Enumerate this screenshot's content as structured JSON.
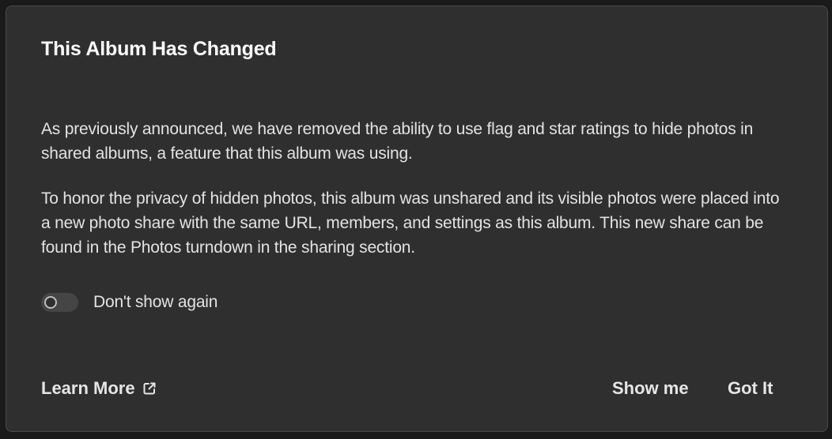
{
  "dialog": {
    "title": "This Album Has Changed",
    "paragraph1": "As previously announced, we have removed the ability to use flag and star ratings to hide photos in shared albums, a feature that this album was using.",
    "paragraph2": "To honor the privacy of hidden photos, this album was unshared and its visible photos were placed into a new photo share with the same URL, members, and settings as this album. This new share can be found in the Photos turndown in the sharing section.",
    "toggle": {
      "label": "Don't show again",
      "checked": false
    },
    "learn_more_label": "Learn More",
    "learn_more_icon": "external-link-icon",
    "show_me_label": "Show me",
    "got_it_label": "Got It"
  },
  "colors": {
    "dialog_background": "#2f2f2f",
    "text": "#e6e6e6",
    "toggle_track": "#454545"
  }
}
